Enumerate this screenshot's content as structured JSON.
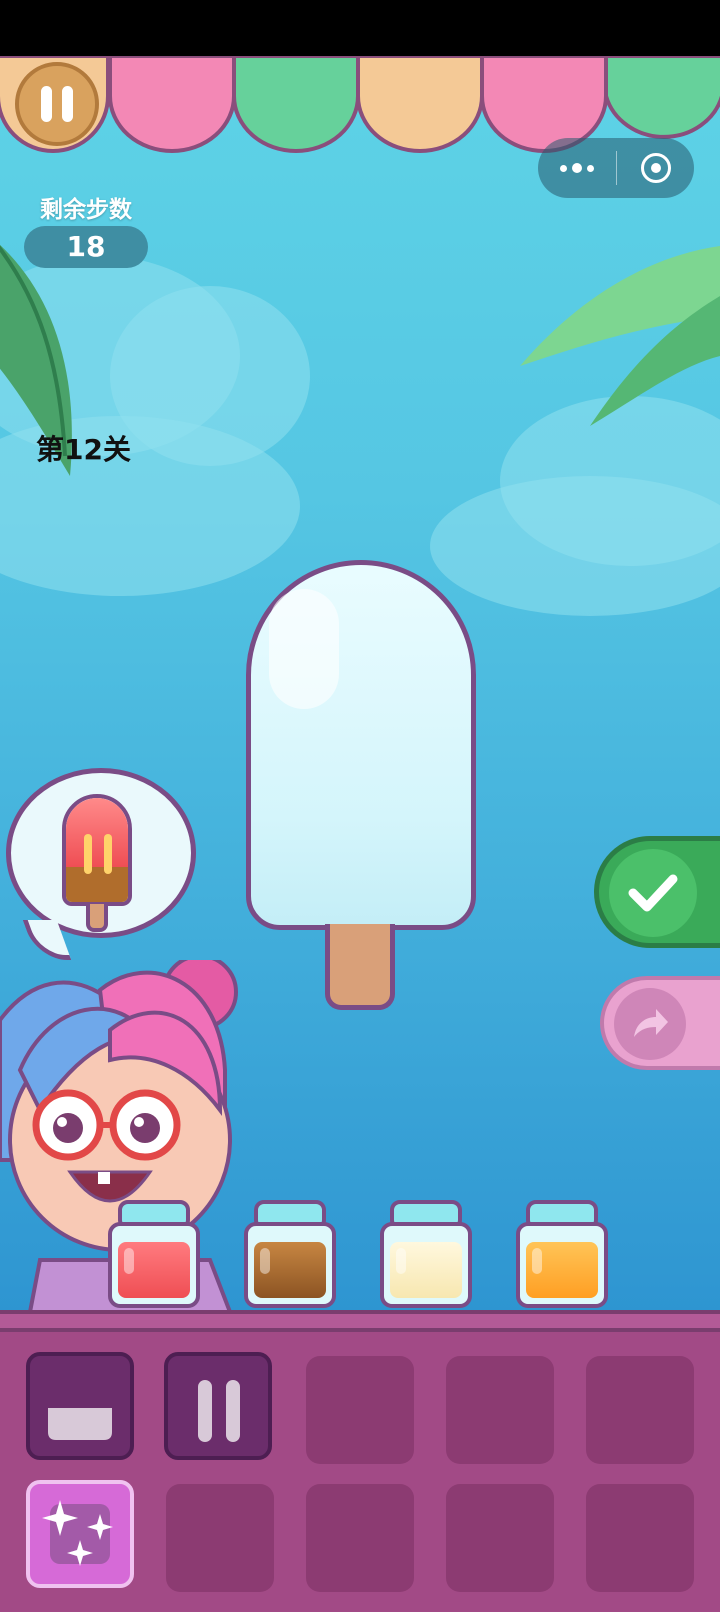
{
  "hud": {
    "steps_label": "剩余步数",
    "steps_value": "18",
    "level_label": "第12关"
  },
  "icons": {
    "pause": "pause-icon",
    "more": "more-dots-icon",
    "close": "target-circle-icon",
    "confirm": "checkmark-icon",
    "share": "share-arrow-icon",
    "bowl": "bowl-icon",
    "sticks": "popsicle-sticks-icon",
    "sparkle": "sparkle-icon"
  },
  "colors": {
    "awning": [
      "#f4c996",
      "#f388b5",
      "#66d19b",
      "#f4c996",
      "#f388b5",
      "#66d19b"
    ],
    "jars": [
      "#ef4e54",
      "#a9652a",
      "#fbf1c8",
      "#ffad33"
    ]
  },
  "jars": [
    {
      "flavor": "strawberry"
    },
    {
      "flavor": "chocolate"
    },
    {
      "flavor": "vanilla"
    },
    {
      "flavor": "orange"
    }
  ]
}
